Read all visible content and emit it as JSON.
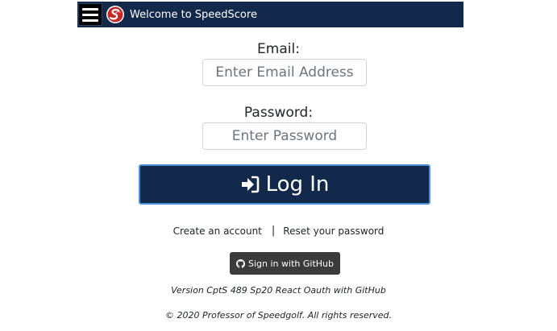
{
  "navbar": {
    "title": "Welcome to SpeedScore",
    "menu_icon": "hamburger-menu-icon",
    "logo_icon": "speedscore-logo"
  },
  "form": {
    "email_label": "Email:",
    "email_placeholder": "Enter Email Address",
    "email_value": "",
    "password_label": "Password:",
    "password_placeholder": "Enter Password",
    "password_value": "",
    "login_label": "Log In",
    "login_icon": "sign-in-icon"
  },
  "links": {
    "create_account": "Create an account",
    "separator": "|",
    "reset_password": "Reset your password"
  },
  "github": {
    "label": "Sign in with GitHub",
    "icon": "github-icon"
  },
  "footer": {
    "version": "Version CptS 489 Sp20 React Oauth with GitHub",
    "copyright": "© 2020 Professor of Speedgolf. All rights reserved."
  },
  "colors": {
    "navbar_bg": "#13294b",
    "login_bg": "#13294b",
    "login_border": "#4a90d9",
    "github_bg": "#3b3b3b"
  }
}
